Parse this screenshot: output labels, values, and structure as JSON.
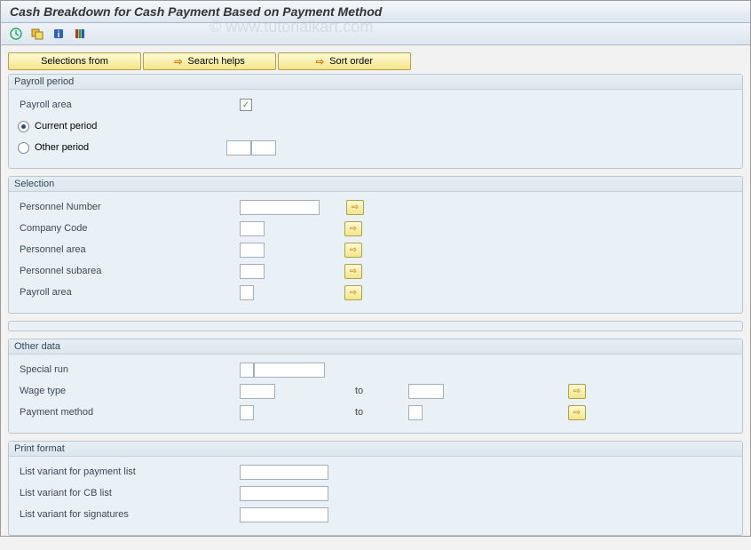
{
  "title": "Cash Breakdown for Cash Payment Based on Payment Method",
  "watermark": "© www.tutorialkart.com",
  "toolbar": {
    "icons": [
      "clock",
      "variant",
      "info",
      "color"
    ]
  },
  "buttons": {
    "selections_from": "Selections from",
    "search_helps": "Search helps",
    "sort_order": "Sort order"
  },
  "groups": {
    "payroll_period": {
      "title": "Payroll period",
      "payroll_area_label": "Payroll area",
      "payroll_area_value": "",
      "current_period": "Current period",
      "other_period": "Other period",
      "other_period_v1": "",
      "other_period_v2": "",
      "selected": "current"
    },
    "selection": {
      "title": "Selection",
      "personnel_number": "Personnel Number",
      "company_code": "Company Code",
      "personnel_area": "Personnel area",
      "personnel_subarea": "Personnel subarea",
      "payroll_area": "Payroll area",
      "values": {
        "personnel_number": "",
        "company_code": "",
        "personnel_area": "",
        "personnel_subarea": "",
        "payroll_area": ""
      }
    },
    "other_data": {
      "title": "Other data",
      "special_run": "Special run",
      "wage_type": "Wage type",
      "payment_method": "Payment method",
      "to": "to",
      "values": {
        "special_run_a": "",
        "special_run_b": "",
        "wage_type_from": "",
        "wage_type_to": "",
        "payment_method_from": "",
        "payment_method_to": ""
      }
    },
    "print_format": {
      "title": "Print format",
      "list_variant_payment": "List variant for payment list",
      "list_variant_cb": "List variant for CB list",
      "list_variant_sign": "List variant for signatures",
      "values": {
        "payment": "",
        "cb": "",
        "sign": ""
      }
    }
  }
}
